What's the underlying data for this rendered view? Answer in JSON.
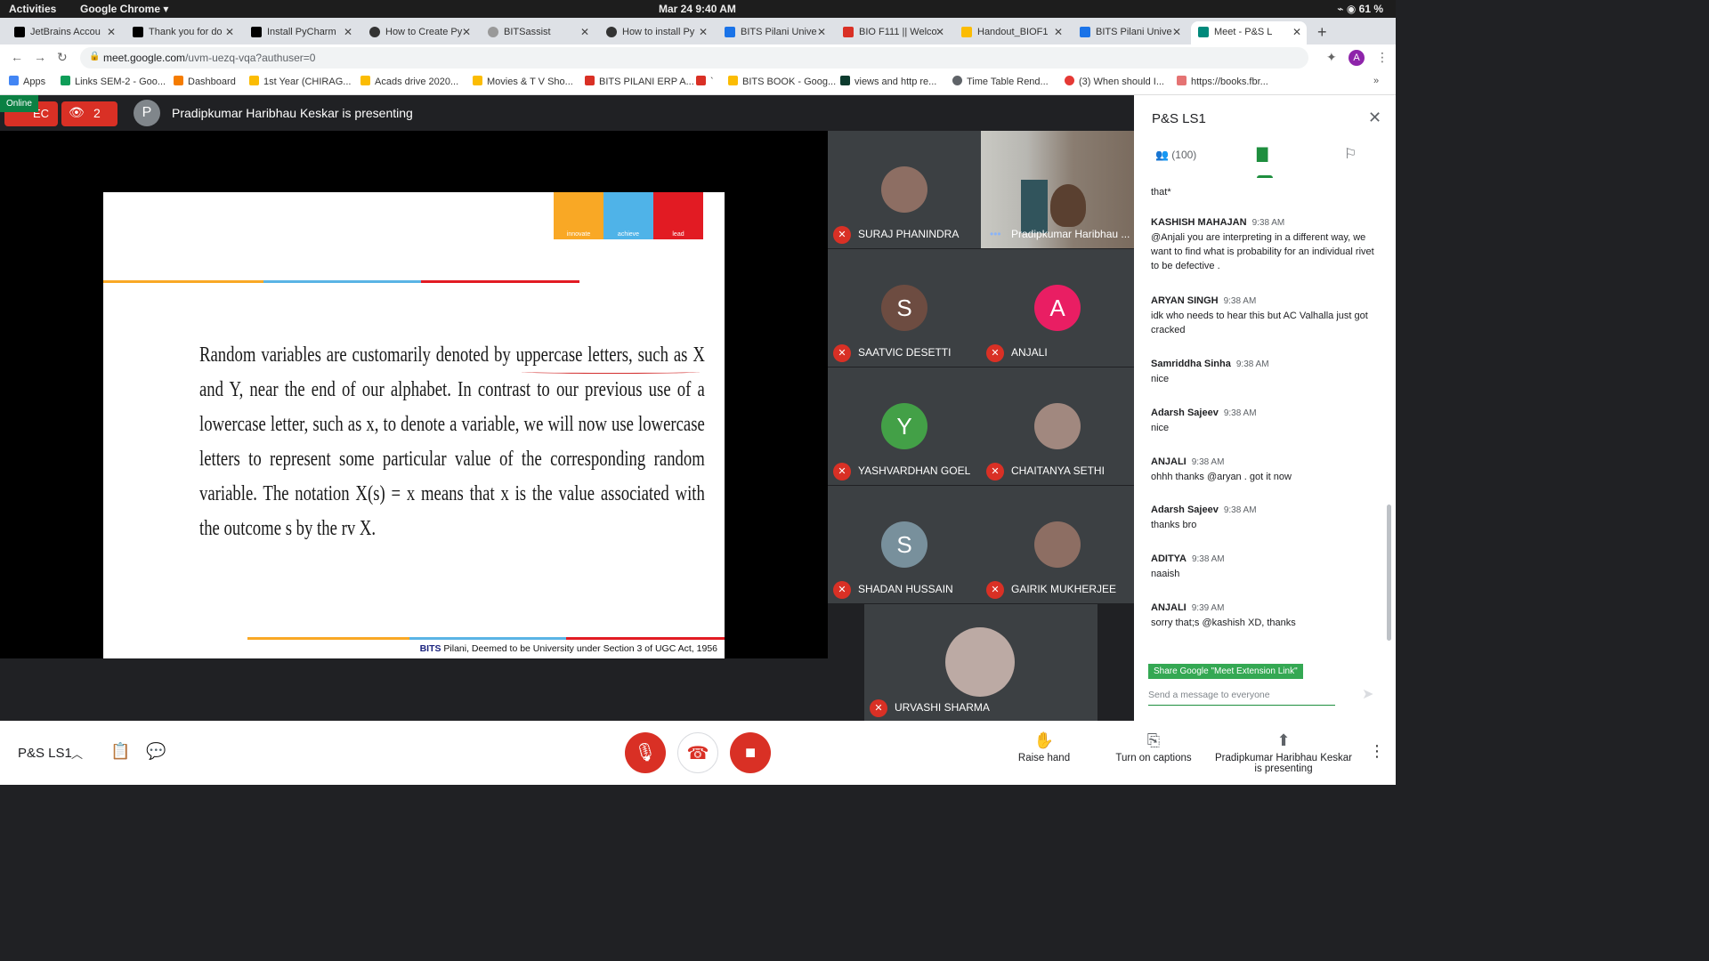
{
  "topbar": {
    "activities": "Activities",
    "app": "Google Chrome ▾",
    "clock": "Mar 24  9:40 AM",
    "battery": "61 %"
  },
  "tabs": [
    {
      "label": "JetBrains Accou",
      "color": "#000000"
    },
    {
      "label": "Thank you for do",
      "color": "#000000"
    },
    {
      "label": "Install PyCharm",
      "color": "#000000"
    },
    {
      "label": "How to Create Py",
      "color": "#333333"
    },
    {
      "label": "BITSassist",
      "color": "#777777"
    },
    {
      "label": "How to install Py",
      "color": "#333333"
    },
    {
      "label": "BITS Pilani Unive",
      "color": "#1a73e8"
    },
    {
      "label": "BIO F111 || Welco",
      "color": "#d93025"
    },
    {
      "label": "Handout_BIOF1",
      "color": "#fbbc04"
    },
    {
      "label": "BITS Pilani Unive",
      "color": "#1a73e8"
    },
    {
      "label": "Meet - P&S L",
      "color": "#00897b"
    }
  ],
  "address": {
    "domain": "meet.google.com",
    "path": "/uvm-uezq-vqa?authuser=0",
    "profile": "A"
  },
  "bookmarks": [
    {
      "label": "Apps",
      "color": "#4285f4"
    },
    {
      "label": "Links SEM-2 - Goo...",
      "color": "#0f9d58"
    },
    {
      "label": "Dashboard",
      "color": "#f57c00"
    },
    {
      "label": "1st Year (CHIRAG...",
      "color": "#fbbc04"
    },
    {
      "label": "Acads drive 2020...",
      "color": "#fbbc04"
    },
    {
      "label": "Movies & T V Sho...",
      "color": "#fbbc04"
    },
    {
      "label": "BITS PILANI ERP A...",
      "color": "#d93025"
    },
    {
      "label": "`",
      "color": "#d93025"
    },
    {
      "label": "BITS BOOK - Goog...",
      "color": "#fbbc04"
    },
    {
      "label": "views and http re...",
      "color": "#0c3b2e"
    },
    {
      "label": "Time Table Rend...",
      "color": "#5f6368"
    },
    {
      "label": "(3) When should I...",
      "color": "#e53935"
    },
    {
      "label": "https://books.fbr...",
      "color": "#e57373"
    }
  ],
  "meet": {
    "rec_label": "EC",
    "online_badge": "Online",
    "viewer_count": "2",
    "presenter_initial": "P",
    "presenting_title": "Pradipkumar Haribhau Keskar is presenting"
  },
  "slide": {
    "logo_labels": [
      "innovate",
      "achieve",
      "lead"
    ],
    "body": "Random variables are customarily denoted by uppercase letters, such as X and Y, near the end of our alphabet. In contrast to our previous use of a lowercase letter, such as x, to denote a variable, we will now use lowercase letters to represent some particular value of the corresponding random variable. The notation X(s) = x means that x is the value associated with the outcome s by the rv X.",
    "footer_bold": "BITS",
    "footer_rest": " Pilani, Deemed to be University under Section 3 of UGC Act, 1956"
  },
  "participants": [
    {
      "name": "SURAJ PHANINDRA",
      "initial": "",
      "color": "#8d6e63"
    },
    {
      "name": "Pradipkumar Haribhau ...",
      "initial": "",
      "color": ""
    },
    {
      "name": "SAATVIC DESETTI",
      "initial": "S",
      "color": "#6d4c41"
    },
    {
      "name": "ANJALI",
      "initial": "A",
      "color": "#e91e63"
    },
    {
      "name": "YASHVARDHAN GOEL",
      "initial": "Y",
      "color": "#43a047"
    },
    {
      "name": "CHAITANYA SETHI",
      "initial": "",
      "color": "#a1887f"
    },
    {
      "name": "SHADAN HUSSAIN",
      "initial": "S",
      "color": "#78909c"
    },
    {
      "name": "GAIRIK MUKHERJEE",
      "initial": "",
      "color": "#8d6e63"
    },
    {
      "name": "URVASHI SHARMA",
      "initial": "",
      "color": "#bcaaa4"
    }
  ],
  "controls": {
    "meeting_name": "P&S LS1",
    "raise_hand": "Raise hand",
    "captions": "Turn on captions",
    "presenting_line1": "Pradipkumar Haribhau Keskar",
    "presenting_line2": "is presenting"
  },
  "panel": {
    "title": "P&S LS1",
    "people_count": "(100)",
    "messages": [
      {
        "sender": "",
        "time": "",
        "text": "that*"
      },
      {
        "sender": "KASHISH MAHAJAN",
        "time": "9:38 AM",
        "text": "@Anjali you are interpreting in a different way, we want to find what is probability for an individual rivet to be defective ."
      },
      {
        "sender": "ARYAN SINGH",
        "time": "9:38 AM",
        "text": "idk who needs to hear this but AC Valhalla just got cracked"
      },
      {
        "sender": "Samriddha Sinha",
        "time": "9:38 AM",
        "text": "nice"
      },
      {
        "sender": "Adarsh Sajeev",
        "time": "9:38 AM",
        "text": "nice"
      },
      {
        "sender": "ANJALI",
        "time": "9:38 AM",
        "text": "ohhh thanks @aryan . got it now"
      },
      {
        "sender": "Adarsh Sajeev",
        "time": "9:38 AM",
        "text": "thanks bro"
      },
      {
        "sender": "ADITYA",
        "time": "9:38 AM",
        "text": "naaish"
      },
      {
        "sender": "ANJALI",
        "time": "9:39 AM",
        "text": "sorry that;s @kashish  XD, thanks"
      }
    ],
    "extension_button": "Share Google \"Meet Extension Link\"",
    "input_placeholder": "Send a message to everyone"
  }
}
